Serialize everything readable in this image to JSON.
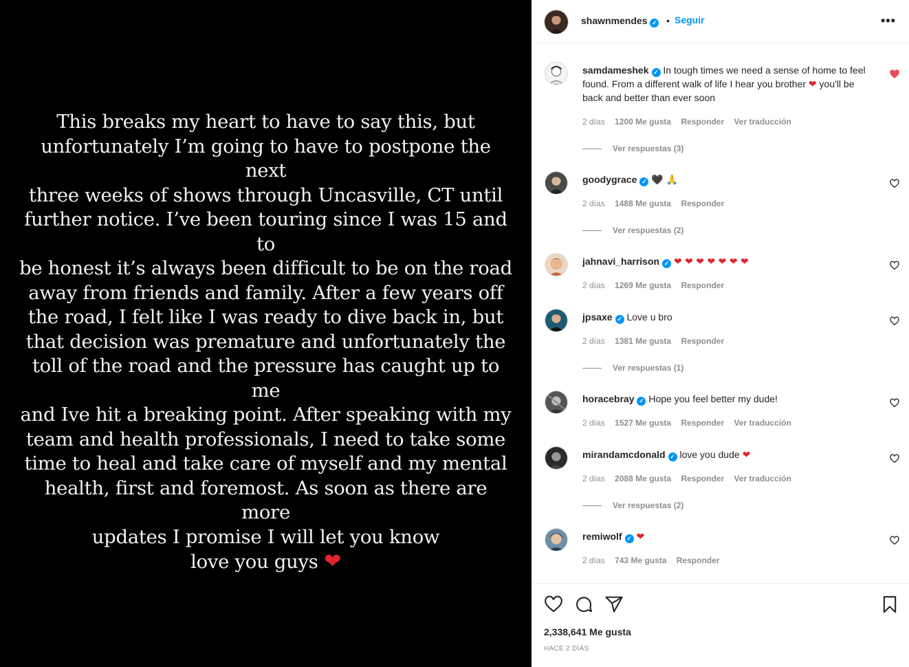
{
  "post": {
    "story_text": "This breaks my heart to have to say this, but\nunfortunately I’m going to have to postpone the next\nthree weeks of shows through Uncasville, CT until\nfurther notice. I’ve been touring since I was 15 and to\nbe honest it’s always been difficult to be on the road\naway from friends and family. After a few years off\nthe road, I felt like I was ready to dive back in, but\nthat decision was premature and unfortunately the\ntoll of the road and the pressure has caught up to me\nand Ive hit a breaking point. After speaking with my\nteam and health professionals, I need to take some\ntime to heal and take care of myself and my mental\nhealth, first and foremost. As soon as there are more\nupdates I promise I will let you know\nlove you guys",
    "story_emoji": "❤"
  },
  "header": {
    "username": "shawnmendes",
    "dot": "•",
    "follow_label": "Seguir",
    "more_icon": "more-options-icon"
  },
  "comments": [
    {
      "username": "samdameshek",
      "text": "In tough times we need a sense of home to feel found. From a different walk of life I hear you brother",
      "text_emoji": "❤",
      "text_after": "you'll be back and better than ever soon",
      "time": "2 días",
      "likes": "1200 Me gusta",
      "reply": "Responder",
      "translate": "Ver traducción",
      "view_replies": "Ver respuestas (3)",
      "liked": true
    },
    {
      "username": "goodygrace",
      "text": "🖤 🙏",
      "time": "2 días",
      "likes": "1488 Me gusta",
      "reply": "Responder",
      "view_replies": "Ver respuestas (2)",
      "liked": false
    },
    {
      "username": "jahnavi_harrison",
      "text": "❤ ❤ ❤ ❤ ❤ ❤ ❤",
      "time": "2 días",
      "likes": "1269 Me gusta",
      "reply": "Responder",
      "liked": false
    },
    {
      "username": "jpsaxe",
      "text": "Love u bro",
      "time": "2 días",
      "likes": "1381 Me gusta",
      "reply": "Responder",
      "view_replies": "Ver respuestas (1)",
      "liked": false
    },
    {
      "username": "horacebray",
      "text": "Hope you feel better my dude!",
      "time": "2 días",
      "likes": "1527 Me gusta",
      "reply": "Responder",
      "translate": "Ver traducción",
      "liked": false
    },
    {
      "username": "mirandamcdonald",
      "text": "love you dude",
      "text_emoji": "❤",
      "time": "2 días",
      "likes": "2088 Me gusta",
      "reply": "Responder",
      "translate": "Ver traducción",
      "view_replies": "Ver respuestas (2)",
      "liked": false
    },
    {
      "username": "remiwolf",
      "text": "❤",
      "time": "2 días",
      "likes": "743 Me gusta",
      "reply": "Responder",
      "liked": false
    }
  ],
  "actions": {
    "likes_count": "2,338,641 Me gusta",
    "posted_time": "HACE 2 DÍAS"
  },
  "colors": {
    "accent": "#0095f6",
    "heart_red": "#ed4956",
    "muted": "#8e8e8e"
  }
}
